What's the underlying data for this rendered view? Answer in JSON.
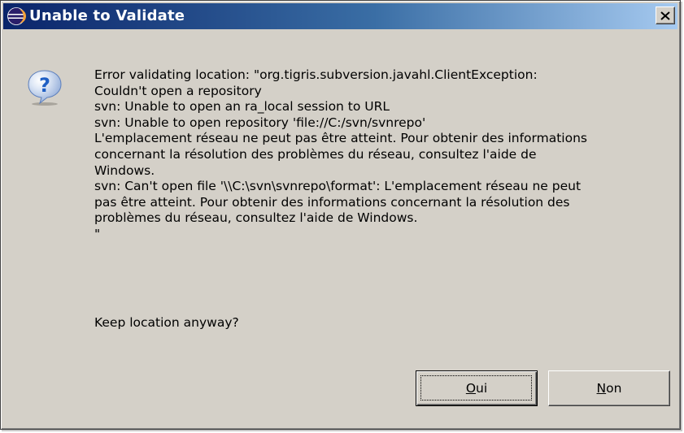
{
  "window": {
    "title": "Unable to Validate",
    "close_label": "×"
  },
  "icons": {
    "app": "eclipse-icon",
    "message": "question-icon",
    "close": "close-icon"
  },
  "message_lines": [
    "Error validating location: \"org.tigris.subversion.javahl.ClientException:",
    "Couldn't open a repository",
    "svn: Unable to open an ra_local session to URL",
    "svn: Unable to open repository 'file://C:/svn/svnrepo'",
    "L'emplacement réseau ne peut pas être atteint. Pour obtenir des informations",
    "concernant la résolution des problèmes du réseau, consultez l'aide de",
    "Windows.",
    "svn: Can't open file '\\\\C:\\svn\\svnrepo\\format': L'emplacement réseau ne peut",
    "pas être atteint. Pour obtenir des informations concernant la résolution des",
    "problèmes du réseau, consultez l'aide de Windows.",
    "\""
  ],
  "prompt": "Keep location anyway?",
  "buttons": {
    "oui": {
      "mnemonic": "O",
      "rest": "ui"
    },
    "non": {
      "mnemonic": "N",
      "rest": "on"
    }
  },
  "colors": {
    "title_gradient_start": "#0a246a",
    "title_gradient_end": "#a6caf0",
    "dialog_bg": "#d4d0c8",
    "question_icon": "#1f5fc4"
  }
}
